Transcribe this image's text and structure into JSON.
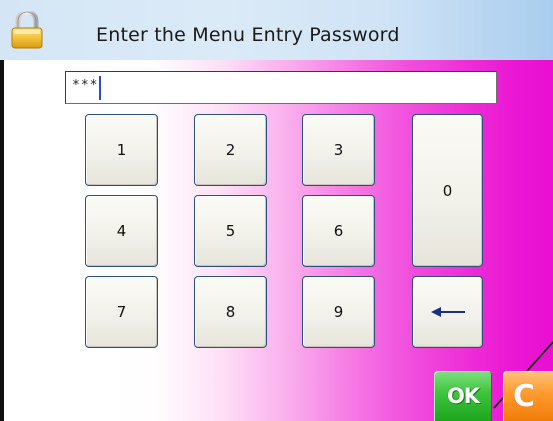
{
  "dialog": {
    "title": "Enter the Menu Entry Password",
    "title_icon": "padlock-icon"
  },
  "password": {
    "value": "***"
  },
  "keypad": {
    "keys": {
      "k1": "1",
      "k2": "2",
      "k3": "3",
      "k4": "4",
      "k5": "5",
      "k6": "6",
      "k7": "7",
      "k8": "8",
      "k9": "9",
      "k0": "0"
    },
    "backspace_icon": "left-arrow-icon"
  },
  "actions": {
    "ok_label": "OK",
    "cancel_label": "C"
  },
  "colors": {
    "ok": "#2fb82f",
    "cancel": "#ff9a2e",
    "background_gradient_end": "#ea0fd2",
    "title_bar": "#d4e6f6",
    "key_border": "#2d4f7f"
  }
}
